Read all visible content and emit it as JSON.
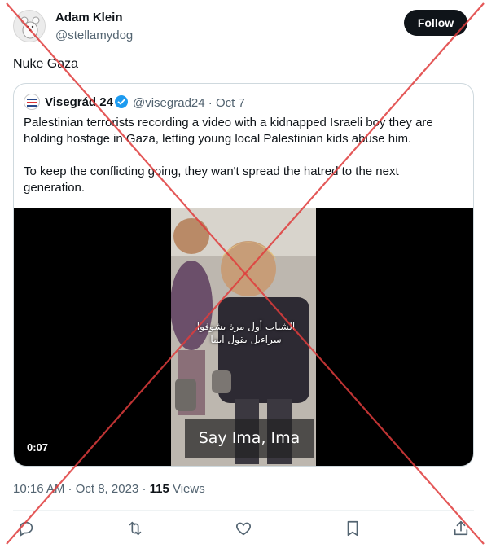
{
  "tweet": {
    "author_name": "Adam Klein",
    "author_handle": "@stellamydog",
    "follow_label": "Follow",
    "text": "Nuke Gaza",
    "timestamp": "10:16 AM · Oct 8, 2023",
    "views_count": "115",
    "views_label": "Views"
  },
  "quote": {
    "author_name": "Visegrád 24",
    "author_handle": "@visegrad24",
    "date": "· Oct 7",
    "paragraph1": "Palestinian terrorists recording a video with a kidnapped Israeli boy they are holding hostage in Gaza, letting young local Palestinian kids abuse him.",
    "paragraph2": "To keep the conflicting going, they wan't spread the hatred to the next generation.",
    "video": {
      "duration": "0:07",
      "overlay_arabic_line1": "الشباب أول مرة يشوفوا",
      "overlay_arabic_line2": "سراءيل بقول ايما",
      "caption": "Say Ima, Ima"
    }
  },
  "actions": [
    "reply-icon",
    "retweet-icon",
    "like-icon",
    "bookmark-icon",
    "share-icon"
  ],
  "colors": {
    "text_primary": "#0f1419",
    "text_secondary": "#536471",
    "follow_bg": "#0f1419",
    "verified_blue": "#1d9bf0",
    "border": "#cfd9de",
    "overlay_x": "#e03c3c"
  }
}
